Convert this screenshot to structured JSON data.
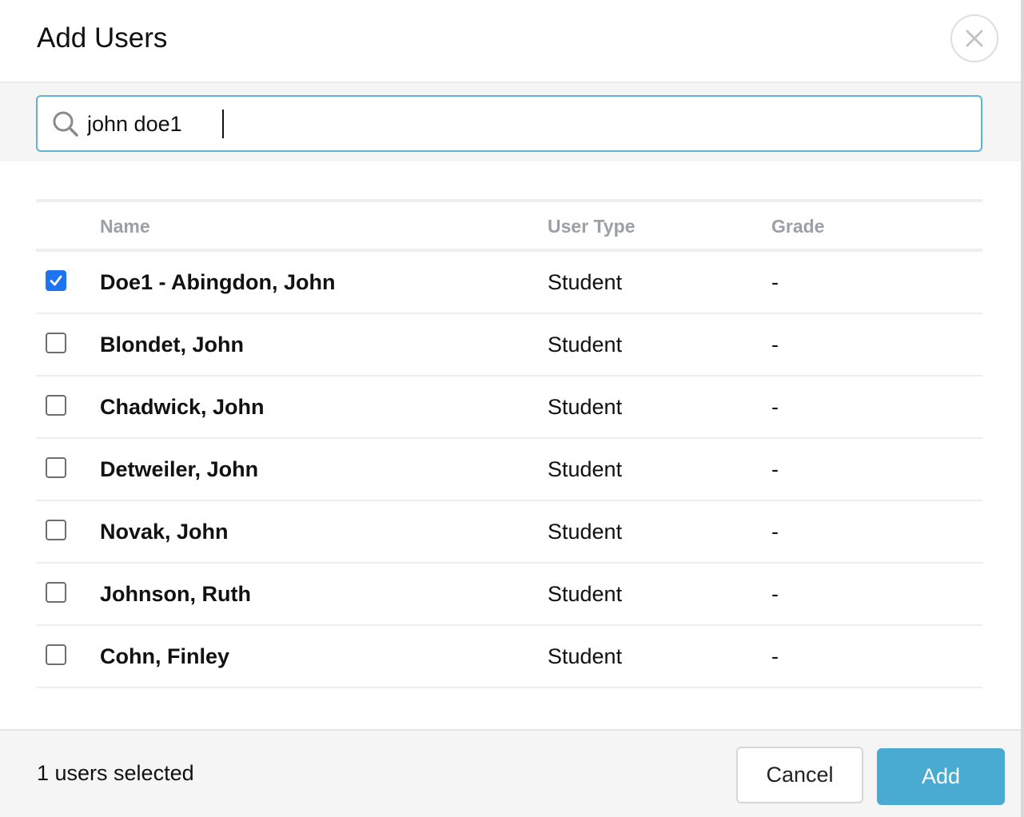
{
  "dialog": {
    "title": "Add Users"
  },
  "search": {
    "value": "john doe1"
  },
  "table": {
    "columns": [
      "Name",
      "User Type",
      "Grade"
    ],
    "rows": [
      {
        "name": "Doe1 - Abingdon, John",
        "user_type": "Student",
        "grade": "-",
        "checked": true
      },
      {
        "name": "Blondet, John",
        "user_type": "Student",
        "grade": "-",
        "checked": false
      },
      {
        "name": "Chadwick, John",
        "user_type": "Student",
        "grade": "-",
        "checked": false
      },
      {
        "name": "Detweiler, John",
        "user_type": "Student",
        "grade": "-",
        "checked": false
      },
      {
        "name": "Novak, John",
        "user_type": "Student",
        "grade": "-",
        "checked": false
      },
      {
        "name": "Johnson, Ruth",
        "user_type": "Student",
        "grade": "-",
        "checked": false
      },
      {
        "name": "Cohn, Finley",
        "user_type": "Student",
        "grade": "-",
        "checked": false
      }
    ]
  },
  "footer": {
    "selected_text": "1 users selected",
    "cancel_label": "Cancel",
    "add_label": "Add"
  },
  "colors": {
    "accent": "#4aabd2",
    "search_border": "#5eb3d6",
    "checkbox_checked": "#1e74f0",
    "header_text": "#9aa0a6"
  },
  "icons": {
    "close": "close-icon",
    "search": "search-icon",
    "check": "checkmark-icon"
  }
}
